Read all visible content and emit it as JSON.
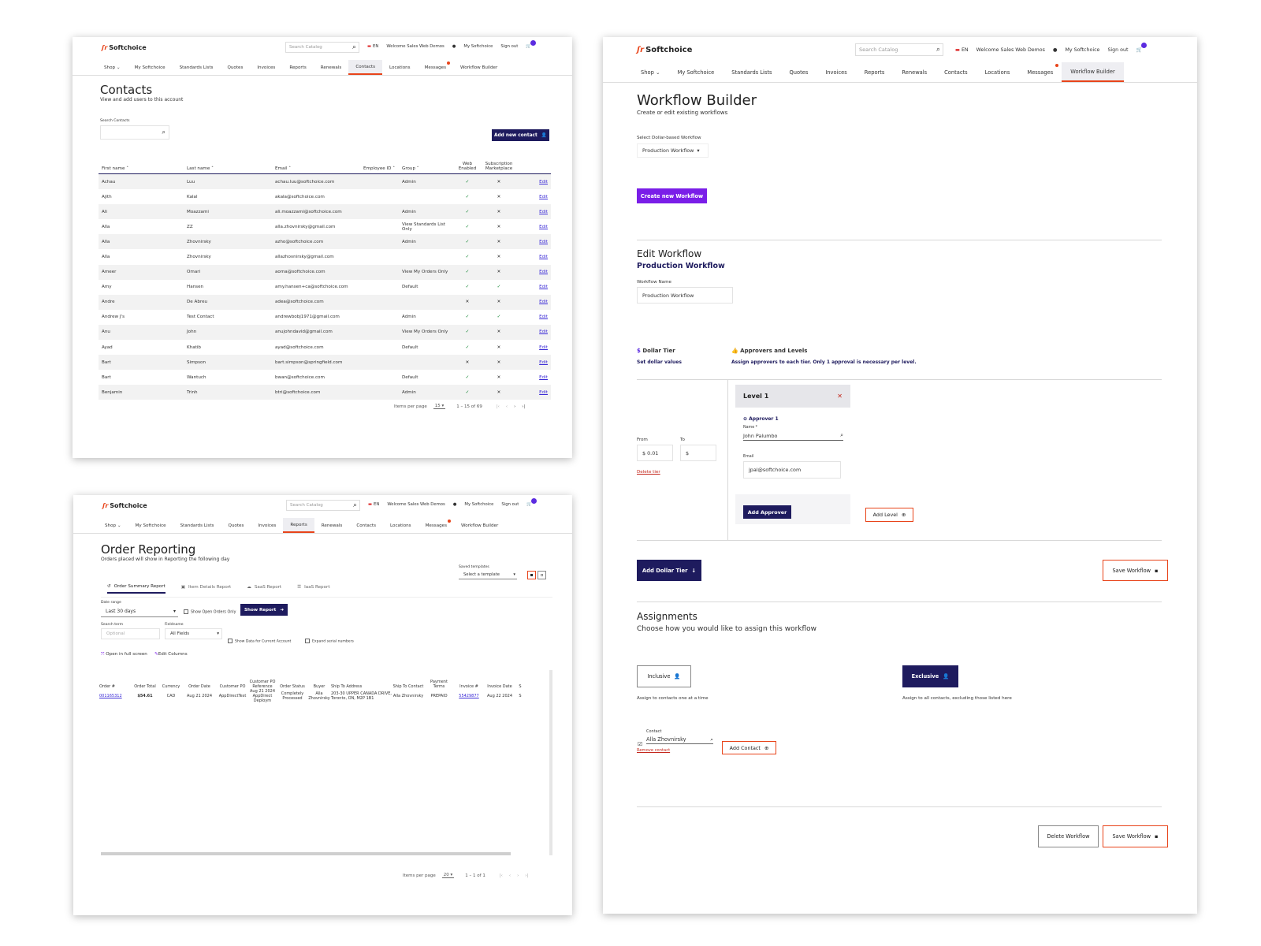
{
  "common": {
    "brand": "Softchoice",
    "search_placeholder": "Search Catalog",
    "lang": "EN",
    "welcome": "Welcome Sales Web Demos",
    "my_softchoice": "My Softchoice",
    "sign_out": "Sign out",
    "nav": [
      "Shop",
      "My Softchoice",
      "Standards Lists",
      "Quotes",
      "Invoices",
      "Reports",
      "Renewals",
      "Contacts",
      "Locations",
      "Messages",
      "Workflow Builder"
    ],
    "accent": "#e8441a",
    "primary": "#1e1b5e",
    "purple": "#7a1ee8"
  },
  "contacts": {
    "title": "Contacts",
    "subtitle": "View and add users to this account",
    "search_label": "Search Contacts",
    "add_button": "Add new contact",
    "columns": [
      "First name",
      "Last name",
      "Email",
      "Employee ID",
      "Group",
      "Web Enabled",
      "Subscription Marketplace",
      ""
    ],
    "rows": [
      {
        "first": "Achau",
        "last": "Luu",
        "email": "achau.luu@softchoice.com",
        "emp": "",
        "group": "Admin",
        "web": true,
        "sub": false
      },
      {
        "first": "Ajith",
        "last": "Kalal",
        "email": "akala@softchoice.com",
        "emp": "",
        "group": "",
        "web": true,
        "sub": false
      },
      {
        "first": "Ali",
        "last": "Moazzami",
        "email": "ali.moazzami@softchoice.com",
        "emp": "",
        "group": "Admin",
        "web": true,
        "sub": false
      },
      {
        "first": "Alla",
        "last": "ZZ",
        "email": "alla.zhovnirsky@gmail.com",
        "emp": "",
        "group": "View Standards List Only",
        "web": true,
        "sub": false
      },
      {
        "first": "Alla",
        "last": "Zhovnirsky",
        "email": "azho@softchoice.com",
        "emp": "",
        "group": "Admin",
        "web": true,
        "sub": false
      },
      {
        "first": "Alla",
        "last": "Zhovnirsky",
        "email": "allazhovnirsky@gmail.com",
        "emp": "",
        "group": "",
        "web": true,
        "sub": false
      },
      {
        "first": "Ameer",
        "last": "Omari",
        "email": "aoma@softchoice.com",
        "emp": "",
        "group": "View My Orders Only",
        "web": true,
        "sub": false
      },
      {
        "first": "Amy",
        "last": "Hansen",
        "email": "amy.hansen+ca@softchoice.com",
        "emp": "",
        "group": "Default",
        "web": true,
        "sub": true
      },
      {
        "first": "Andre",
        "last": "De Abreu",
        "email": "adea@softchoice.com",
        "emp": "",
        "group": "",
        "web": false,
        "sub": false
      },
      {
        "first": "Andrew J's",
        "last": "Test Contact",
        "email": "andrewbobj1971@gmail.com",
        "emp": "",
        "group": "Admin",
        "web": true,
        "sub": true
      },
      {
        "first": "Anu",
        "last": "John",
        "email": "anujohndavid@gmail.com",
        "emp": "",
        "group": "View My Orders Only",
        "web": true,
        "sub": false
      },
      {
        "first": "Ayad",
        "last": "Khatib",
        "email": "ayad@softchoice.com",
        "emp": "",
        "group": "Default",
        "web": true,
        "sub": false
      },
      {
        "first": "Bart",
        "last": "Simpson",
        "email": "bart.simpson@springfield.com",
        "emp": "",
        "group": "",
        "web": false,
        "sub": false
      },
      {
        "first": "Bart",
        "last": "Wantuch",
        "email": "bwan@softchoice.com",
        "emp": "",
        "group": "Default",
        "web": true,
        "sub": false
      },
      {
        "first": "Benjamin",
        "last": "Trinh",
        "email": "btri@softchoice.com",
        "emp": "",
        "group": "Admin",
        "web": true,
        "sub": false
      }
    ],
    "edit_label": "Edit",
    "items_per_page_label": "Items per page",
    "items_per_page": "15",
    "range": "1 – 15 of 69"
  },
  "orders": {
    "title": "Order Reporting",
    "subtitle": "Orders placed will show in Reporting the following day",
    "saved_templates_label": "Saved templates",
    "saved_templates_value": "Select a template",
    "tabs": [
      "Order Summary Report",
      "Item Details Report",
      "SaaS Report",
      "IaaS Report"
    ],
    "date_range_label": "Date range",
    "date_range_value": "Last 30 days",
    "show_open_orders": "Show Open Orders Only",
    "show_report": "Show Report",
    "search_term_label": "Search term",
    "search_term_placeholder": "Optional",
    "fieldname_label": "Fieldname",
    "fieldname_value": "All Fields",
    "show_current_account": "Show Data for Current Account",
    "expand_serials": "Expand serial numbers",
    "open_full_screen": "Open in full screen",
    "edit_columns": "Edit Columns",
    "columns": [
      "Order #",
      "Order Total",
      "Currency",
      "Order Date",
      "Customer PO",
      "Customer PO Reference",
      "Order Status",
      "Buyer",
      "Ship To Address",
      "Ship To Contact",
      "Payment Terms",
      "Invoice #",
      "Invoice Date",
      "S"
    ],
    "rows": [
      [
        "001165312",
        "$54.61",
        "CAD",
        "Aug 21 2024",
        "AppDirectTest",
        "Aug 21 2024 AppDirect Deploym",
        "Completely Processed",
        "Alla Zhovnirsky",
        "203-30 UPPER CANADA DRIVE, Toronto, ON, M2P 1B1",
        "Alla Zhovnirsky",
        "PREPAID",
        "55429877",
        "Aug 22 2024",
        "S"
      ]
    ],
    "items_per_page_label": "Items per page",
    "items_per_page": "20",
    "range": "1 – 1 of 1"
  },
  "workflow": {
    "title": "Workflow Builder",
    "subtitle": "Create or edit existing workflows",
    "select_label": "Select Dollar-based Workflow",
    "select_value": "Production Workflow",
    "create_button": "Create new Workflow",
    "edit_title": "Edit Workflow",
    "edit_subtitle": "Production Workflow",
    "name_label": "Workflow Name",
    "name_value": "Production Workflow",
    "dollar_tier_title": "Dollar Tier",
    "dollar_tier_sub": "Set dollar values",
    "approvers_title": "Approvers and Levels",
    "approvers_sub": "Assign approvers to each tier. Only 1 approval is necessary per level.",
    "from_label": "From",
    "from_value": "$ 0.01",
    "to_label": "To",
    "to_value": "$",
    "delete_tier": "Delete tier",
    "level_title": "Level 1",
    "approver_title": "Approver 1",
    "approver_name_label": "Name *",
    "approver_name": "John Palumbo",
    "approver_email_label": "Email",
    "approver_email": "jpal@softchoice.com",
    "add_approver": "Add Approver",
    "add_level": "Add Level",
    "add_dollar_tier": "Add Dollar Tier",
    "save_workflow": "Save Workflow",
    "assign_title": "Assignments",
    "assign_sub": "Choose how you would like to assign this workflow",
    "inclusive": "Inclusive",
    "inclusive_desc": "Assign to contacts one at a time",
    "exclusive": "Exclusive",
    "exclusive_desc": "Assign to all contacts, excluding those listed here",
    "contact_label": "Contact",
    "contact_value": "Alla Zhovnirsky",
    "remove_contact": "Remove contact",
    "add_contact": "Add Contact",
    "delete_workflow": "Delete Workflow"
  }
}
